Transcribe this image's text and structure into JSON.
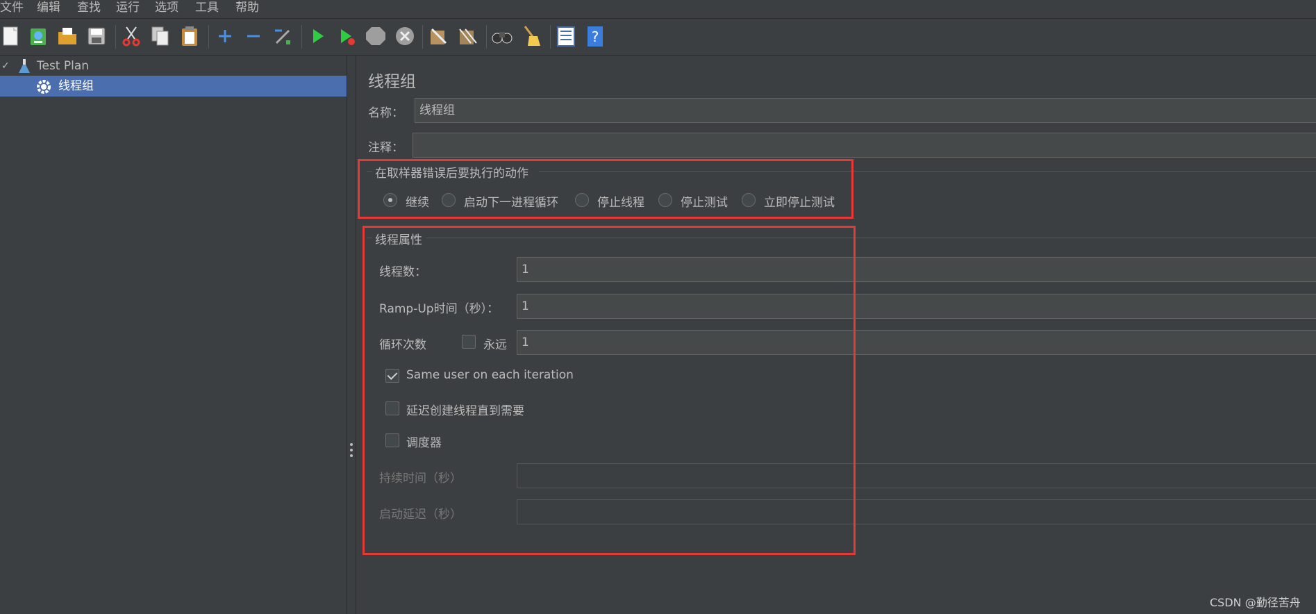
{
  "menu": [
    "文件",
    "编辑",
    "查找",
    "运行",
    "选项",
    "工具",
    "帮助"
  ],
  "toolbar_icons": [
    "new-document-icon",
    "templates-icon",
    "open-icon",
    "save-icon",
    "cut-icon",
    "copy-icon",
    "paste-icon",
    "expand-plus-icon",
    "collapse-minus-icon",
    "toggle-icon",
    "start-icon",
    "start-no-pause-icon",
    "stop-icon",
    "shutdown-icon",
    "clear-icon",
    "clear-all-icon",
    "search-binoculars-icon",
    "reset-search-broom-icon",
    "function-helper-icon",
    "help-icon"
  ],
  "tree": {
    "root_label": "Test Plan",
    "child_label": "线程组"
  },
  "panel": {
    "title": "线程组",
    "name_label": "名称：",
    "name_value": "线程组",
    "comment_label": "注释：",
    "comment_value": ""
  },
  "error_action": {
    "title": "在取样器错误后要执行的动作",
    "options": [
      "继续",
      "启动下一进程循环",
      "停止线程",
      "停止测试",
      "立即停止测试"
    ],
    "selected": "继续"
  },
  "thread_props": {
    "title": "线程属性",
    "threads_label": "线程数：",
    "threads_value": "1",
    "rampup_label": "Ramp-Up时间（秒）：",
    "rampup_value": "1",
    "loop_label": "循环次数",
    "forever_label": "永远",
    "forever_checked": false,
    "loop_value": "1",
    "same_user_label": "Same user on each iteration",
    "same_user_checked": true,
    "delay_label": "延迟创建线程直到需要",
    "delay_checked": false,
    "scheduler_label": "调度器",
    "scheduler_checked": false,
    "duration_label": "持续时间（秒）",
    "duration_value": "",
    "startup_delay_label": "启动延迟（秒）",
    "startup_delay_value": ""
  },
  "watermark": "CSDN @勤径苦舟",
  "colors": {
    "background": "#3c3f41",
    "selection": "#4b6eaf",
    "highlight_box": "#e53935",
    "field_bg": "#45494a"
  }
}
